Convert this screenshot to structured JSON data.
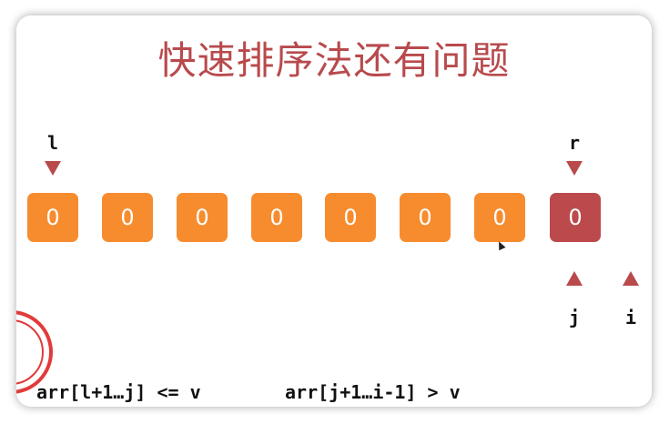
{
  "slide": {
    "title": "快速排序法还有问题",
    "pointers": {
      "l": "l",
      "r": "r",
      "j": "j",
      "i": "i"
    },
    "cells": [
      "0",
      "0",
      "0",
      "0",
      "0",
      "0",
      "0",
      "0"
    ],
    "formula_left": "arr[l+1…j] <= v",
    "formula_right": "arr[j+1…i-1] > v"
  },
  "colors": {
    "title": "#b84a4d",
    "cell": "#f78c2f",
    "pivot_cell": "#bc4a4d",
    "pointer": "#b94a4c"
  }
}
